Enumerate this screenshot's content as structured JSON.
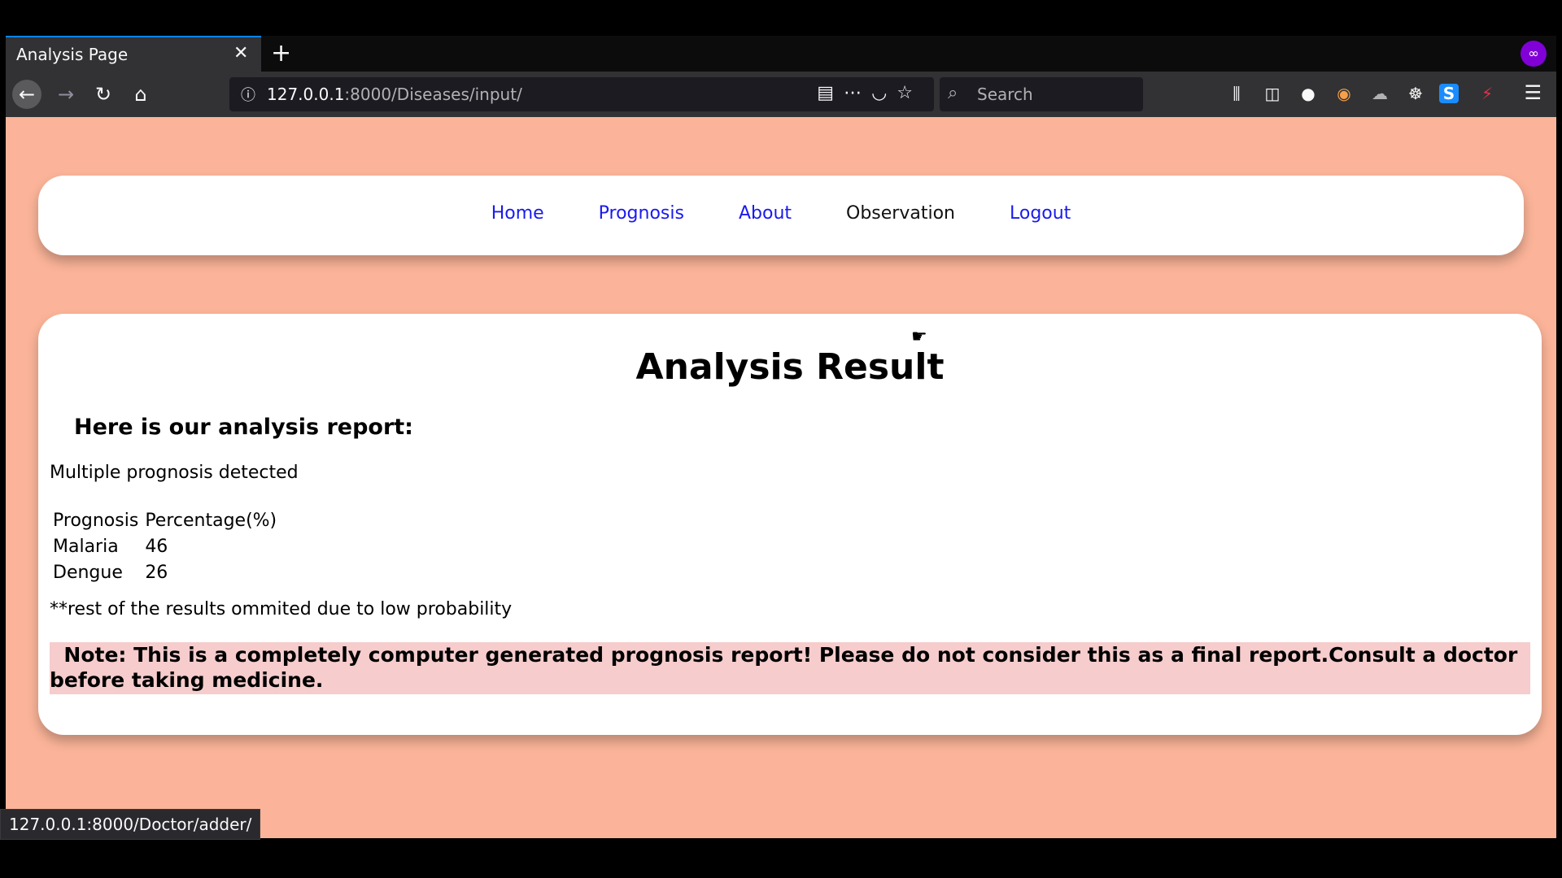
{
  "browser": {
    "tab_title": "Analysis Page",
    "tab_close": "✕",
    "new_tab": "+",
    "url_host": "127.0.0.1",
    "url_path": ":8000/Diseases/input/",
    "search_placeholder": "Search",
    "status_url": "127.0.0.1:8000/Doctor/adder/",
    "icons": [
      "back-icon",
      "forward-icon",
      "reload-icon",
      "home-icon",
      "info-icon",
      "reader-view-icon",
      "more-icon",
      "pocket-icon",
      "bookmark-star-icon",
      "search-icon",
      "library-icon",
      "sidebar-icon",
      "account-icon",
      "extension-icon",
      "menu-icon"
    ]
  },
  "nav": {
    "home": "Home",
    "prognosis": "Prognosis",
    "about": "About",
    "observation": "Observation",
    "logout": "Logout"
  },
  "result": {
    "title": "Analysis Result",
    "report_heading": "Here is our analysis report:",
    "detected": "Multiple prognosis detected",
    "table": {
      "headers": [
        "Prognosis",
        "Percentage(%)"
      ],
      "rows": [
        [
          "Malaria",
          "46"
        ],
        [
          "Dengue",
          "26"
        ]
      ]
    },
    "omitted": "**rest of the results ommited due to low probability",
    "note": "Note:  This is a completely computer generated prognosis report! Please do not consider this as a final report.Consult a doctor before taking medicine."
  },
  "colors": {
    "page_bg": "#fbb499",
    "link": "#1a1aee",
    "note_bg": "#f6cccc",
    "tab_accent": "#0a84ff"
  }
}
